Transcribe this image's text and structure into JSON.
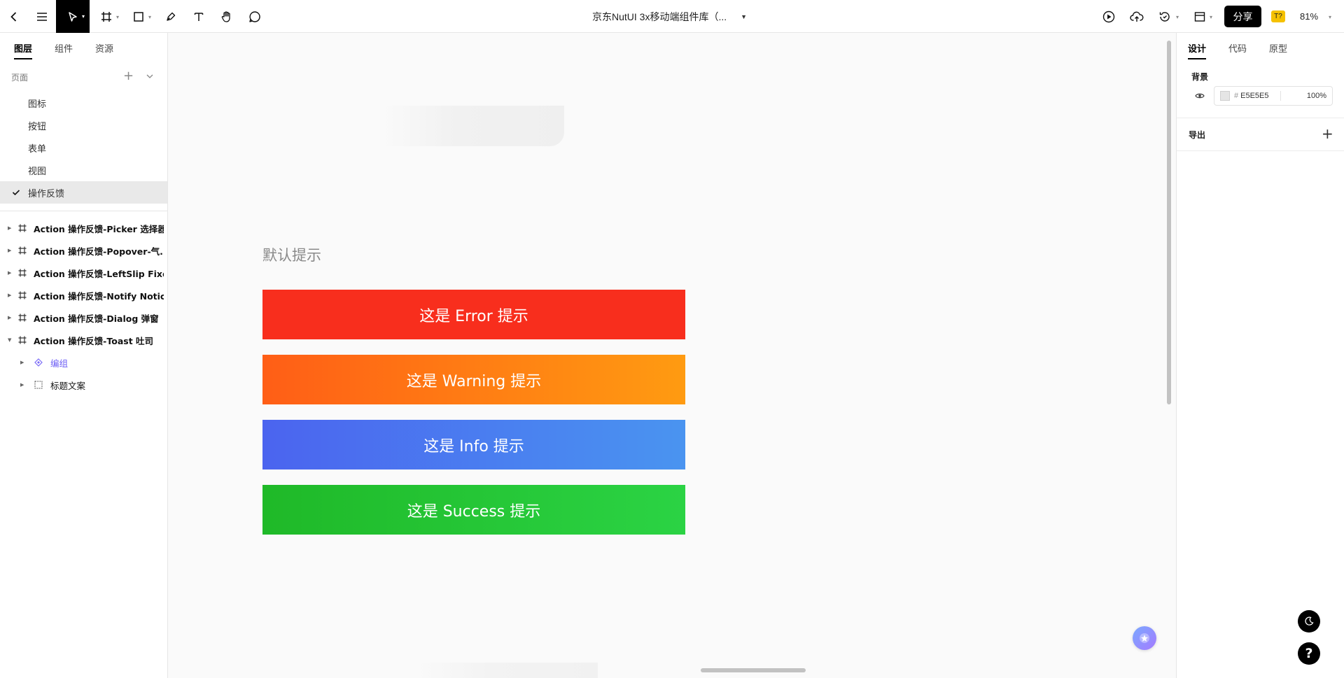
{
  "toolbar": {
    "document_title": "京东NutUI 3x移动端组件库（...",
    "share_label": "分享",
    "user_badge": "T?",
    "zoom": "81%"
  },
  "left_panel": {
    "tabs": [
      "图层",
      "组件",
      "资源"
    ],
    "pages_header": "页面",
    "pages": [
      {
        "label": "图标",
        "selected": false
      },
      {
        "label": "按钮",
        "selected": false
      },
      {
        "label": "表单",
        "selected": false
      },
      {
        "label": "视图",
        "selected": false
      },
      {
        "label": "操作反馈",
        "selected": true
      }
    ],
    "layers": [
      {
        "label": "Action 操作反馈-Picker 选择器",
        "expanded": false
      },
      {
        "label": "Action 操作反馈-Popover-气...",
        "expanded": false
      },
      {
        "label": "Action 操作反馈-LeftSlip Fixe...",
        "expanded": false
      },
      {
        "label": "Action 操作反馈-Notify Notic...",
        "expanded": false
      },
      {
        "label": "Action 操作反馈-Dialog 弹窗",
        "expanded": false
      },
      {
        "label": "Action 操作反馈-Toast 吐司",
        "expanded": true
      }
    ],
    "child_layers": [
      {
        "label": "编组",
        "icon": "component-icon"
      },
      {
        "label": "标题文案",
        "icon": "group-frame-icon"
      }
    ]
  },
  "canvas": {
    "section_title": "默认提示",
    "toasts": {
      "error": "这是 Error 提示",
      "warning": "这是 Warning 提示",
      "info": "这是 Info 提示",
      "success": "这是 Success 提示"
    },
    "colors": {
      "error": "#f82e1d",
      "warning_start": "#ff5e16",
      "warning_end": "#ff9b11",
      "info_start": "#4b64ef",
      "info_end": "#4a94f0",
      "success_start": "#1fb928",
      "success_end": "#2bd344"
    }
  },
  "right_panel": {
    "tabs": [
      "设计",
      "代码",
      "原型"
    ],
    "background_title": "背景",
    "background_hex": "E5E5E5",
    "background_hash": "#",
    "background_opacity": "100%",
    "export_title": "导出"
  },
  "help_label": "?"
}
